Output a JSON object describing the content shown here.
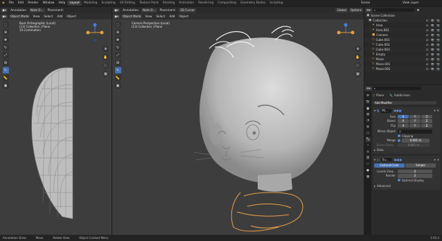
{
  "topbar": {
    "menus": [
      "File",
      "Edit",
      "Render",
      "Window",
      "Help"
    ],
    "workspaces": [
      "Layout",
      "Modeling",
      "Sculpting",
      "UV Editing",
      "Texture Paint",
      "Shading",
      "Animation",
      "Rendering",
      "Compositing",
      "Geometry Nodes",
      "Scripting"
    ],
    "scene": "Scene",
    "view_layer": "View Layer"
  },
  "annot": {
    "mode": "Annotation",
    "placement_label": "Placement:",
    "note": "Note D...",
    "cursor": "3D Cursor",
    "global": "Global",
    "options": "Options"
  },
  "left_vp": {
    "mode": "Object Mode",
    "view": "View",
    "select": "Select",
    "add": "Add",
    "object": "Object",
    "ov1": "Back Orthographic (Local)",
    "ov2": "(13) Collection | Plane",
    "ov3": "10 Centimeters"
  },
  "mid_vp": {
    "mode": "Object Mode",
    "view": "View",
    "select": "Select",
    "add": "Add",
    "object": "Object",
    "ov1": "Camera Perspective (Local)",
    "ov2": "(13) Collection | Plane"
  },
  "outliner": {
    "header": "Scene Collection",
    "rows": [
      {
        "label": "Collection",
        "icon": "▣"
      },
      {
        "label": "Area",
        "icon": "✦"
      },
      {
        "label": "Area.001",
        "icon": "✦"
      },
      {
        "label": "Camera",
        "icon": "■"
      },
      {
        "label": "Cube.001",
        "icon": "▽"
      },
      {
        "label": "Cube.002",
        "icon": "▽"
      },
      {
        "label": "Cube.003",
        "icon": "▽"
      },
      {
        "label": "Empty",
        "icon": "✕"
      },
      {
        "label": "Plane",
        "icon": "▽"
      },
      {
        "label": "Plane.001",
        "icon": "▽"
      },
      {
        "label": "Plane.002",
        "icon": "▽"
      }
    ]
  },
  "props": {
    "object": "Plane",
    "modifier_name": "Subdivision",
    "add_modifier": "Add Modifier",
    "mirror": {
      "name": "Mi...",
      "axis_label": "Axis",
      "bisect_label": "Bisect",
      "flip_label": "Flip",
      "x": "X",
      "y": "Y",
      "z": "Z",
      "mirror_object": "Mirror Object",
      "clipping": "Clipping",
      "merge": "Merge",
      "merge_value": "0.001 m",
      "bisect_dist": "Bisect Dista...",
      "bisect_dist_value": "0.001 m",
      "data": "Data"
    },
    "subsurf": {
      "name": "Su...",
      "catmull": "Catmull-Clark",
      "simple": "Simple",
      "levels_label": "Levels View...",
      "levels": "2",
      "render_label": "Render",
      "render": "2",
      "optimal": "Optimal Display",
      "advanced": "Advanced"
    }
  },
  "status": {
    "s1": "Annotation Draw",
    "s2": "Move",
    "s3": "Rotate View",
    "s4": "Object Context Menu",
    "version": "2.93.4"
  },
  "colors": {
    "accent": "#4772b3",
    "outline": "#e8a048"
  }
}
